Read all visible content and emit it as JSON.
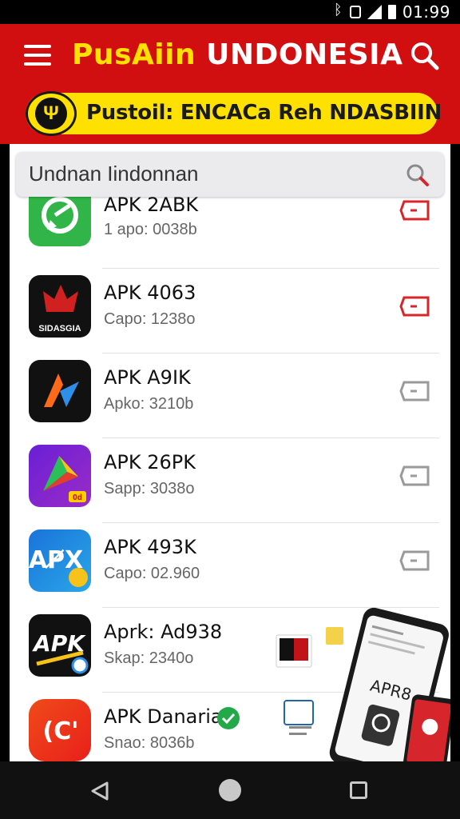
{
  "status_bar": {
    "time": "01:99"
  },
  "app_bar": {
    "title_part1": "PusAiin",
    "title_part2": "UNDONESIA",
    "banner_text": "Pustoil: ENCACa Reh NDASBIIN"
  },
  "search": {
    "value": "Undnan Iindonnan"
  },
  "items": [
    {
      "name": "APK 2ABK",
      "sub": "1 apo: 0038b",
      "icon_label": "",
      "accent": "#d7262b"
    },
    {
      "name": "APK 4063",
      "sub": "Capo: 1238o",
      "icon_label": "SIDASGIA",
      "accent": "#d7262b"
    },
    {
      "name": "APK A9IK",
      "sub": "Apko: 3210b",
      "icon_label": "",
      "accent": "#9a9a9a"
    },
    {
      "name": "APK 26PK",
      "sub": "Sapp: 3038o",
      "icon_label": "0d",
      "accent": "#9a9a9a"
    },
    {
      "name": "APK 493K",
      "sub": "Capo: 02.960",
      "icon_label": "AP̸X",
      "accent": "#9a9a9a"
    },
    {
      "name": "Aprk: Ad938",
      "sub": "Skap: 2340o",
      "icon_label": "APK",
      "accent": "#9a9a9a"
    },
    {
      "name": "APK Danaria",
      "sub": "Snao: 8036b",
      "icon_label": "(C'",
      "accent": "#9a9a9a"
    }
  ],
  "phone_screen_text": "APR8",
  "colors": {
    "brand_red": "#d10f10",
    "brand_yellow": "#ffe100",
    "download_red": "#d7262b",
    "download_gray": "#9a9a9a"
  }
}
